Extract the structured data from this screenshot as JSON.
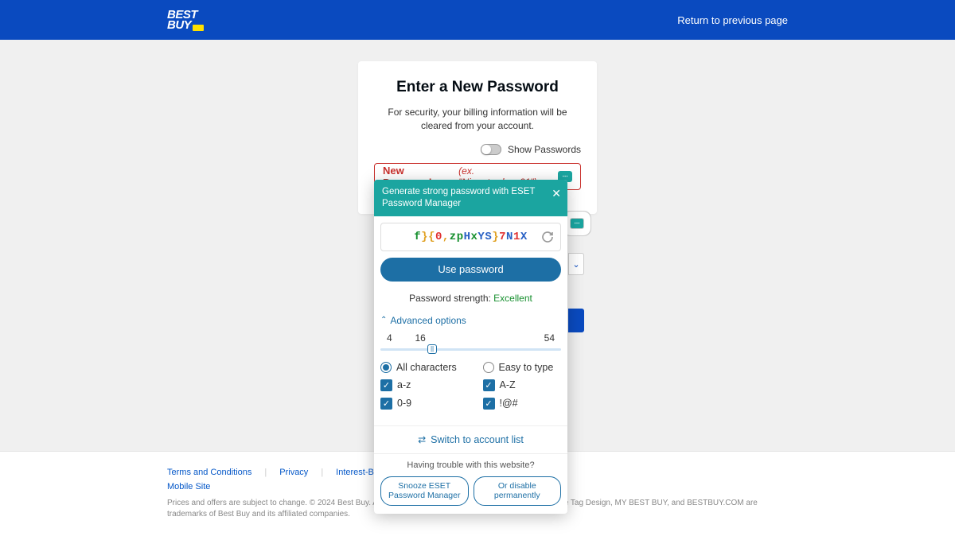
{
  "header": {
    "logo_line1": "BEST",
    "logo_line2": "BUY",
    "return_link": "Return to previous page"
  },
  "card": {
    "title": "Enter a New Password",
    "subtitle": "For security, your billing information will be cleared from your account.",
    "show_passwords": "Show Passwords",
    "field_label": "New Password",
    "field_hint": "(ex. \"Nine+twelve=21\")"
  },
  "popup": {
    "header": "Generate strong password with ESET Password Manager",
    "generated": [
      {
        "t": "f",
        "c": "c2"
      },
      {
        "t": "}",
        "c": "c4"
      },
      {
        "t": "{",
        "c": "c4"
      },
      {
        "t": "0",
        "c": "c1"
      },
      {
        "t": ",",
        "c": "c4"
      },
      {
        "t": "z",
        "c": "c2"
      },
      {
        "t": "p",
        "c": "c2"
      },
      {
        "t": "H",
        "c": "c3"
      },
      {
        "t": "x",
        "c": "c2"
      },
      {
        "t": "Y",
        "c": "c3"
      },
      {
        "t": "S",
        "c": "c3"
      },
      {
        "t": "}",
        "c": "c4"
      },
      {
        "t": "7",
        "c": "c1"
      },
      {
        "t": "N",
        "c": "c3"
      },
      {
        "t": "1",
        "c": "c1"
      },
      {
        "t": "X",
        "c": "c3"
      }
    ],
    "use_password": "Use password",
    "strength_label": "Password strength: ",
    "strength_value": "Excellent",
    "advanced": "Advanced options",
    "slider": {
      "min": "4",
      "mid": "16",
      "max": "54"
    },
    "radios": {
      "all": "All characters",
      "easy": "Easy to type"
    },
    "checks": {
      "lower": "a-z",
      "upper": "A-Z",
      "digits": "0-9",
      "symbols": "!@#"
    },
    "switch": "Switch to account list",
    "trouble": "Having trouble with this website?",
    "snooze": "Snooze ESET Password Manager",
    "disable": "Or disable permanently"
  },
  "footer": {
    "links": [
      "Terms and Conditions",
      "Privacy",
      "Interest-Based Ads"
    ],
    "mobile": "Mobile Site",
    "copyright": "Prices and offers are subject to change. © 2024 Best Buy. All rights reserved. BEST BUY, the BEST BUY logo, the Tag Design, MY BEST BUY, and BESTBUY.COM are trademarks of Best Buy and its affiliated companies."
  }
}
